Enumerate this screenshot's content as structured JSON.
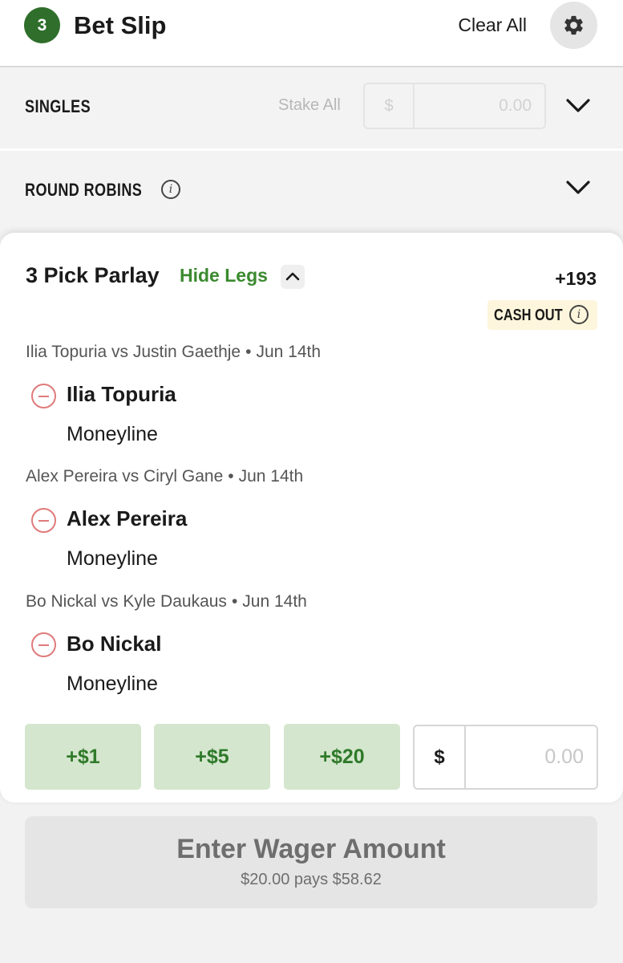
{
  "header": {
    "count": "3",
    "title": "Bet Slip",
    "clear_all": "Clear All",
    "settings_icon": "gear-icon"
  },
  "singles": {
    "label": "SINGLES",
    "stake_all_label": "Stake All",
    "currency": "$",
    "value": "0.00"
  },
  "round_robins": {
    "label": "ROUND ROBINS"
  },
  "parlay": {
    "title": "3 Pick Parlay",
    "toggle_label": "Hide Legs",
    "odds": "+193",
    "cash_out": "CASH OUT",
    "legs": [
      {
        "matchup": "Ilia Topuria vs Justin Gaethje",
        "date": "Jun 14th",
        "pick": "Ilia Topuria",
        "market": "Moneyline"
      },
      {
        "matchup": "Alex Pereira vs Ciryl Gane",
        "date": "Jun 14th",
        "pick": "Alex Pereira",
        "market": "Moneyline"
      },
      {
        "matchup": "Bo Nickal vs Kyle Daukaus",
        "date": "Jun 14th",
        "pick": "Bo Nickal",
        "market": "Moneyline"
      }
    ],
    "quick_amounts": [
      "+$1",
      "+$5",
      "+$20"
    ],
    "wager_currency": "$",
    "wager_value": "0.00"
  },
  "submit": {
    "label": "Enter Wager Amount",
    "sub_label": "$20.00 pays $58.62"
  },
  "colors": {
    "brand_green": "#2f6e2b",
    "link_green": "#3a8a2e",
    "quick_bg": "#d4e6cd",
    "remove_red": "#e07a7a",
    "cashout_bg": "#fdf6dd"
  }
}
